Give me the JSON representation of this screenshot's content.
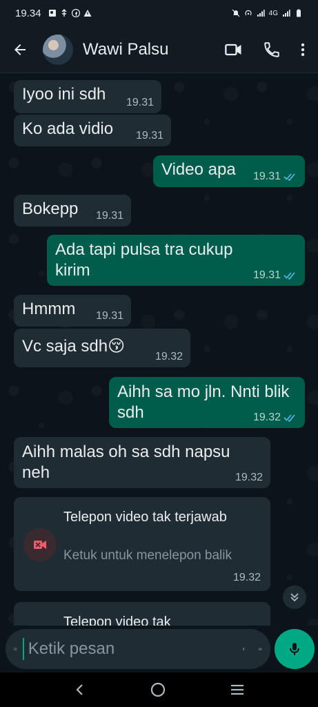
{
  "status_bar": {
    "time": "19.34",
    "network": "4G"
  },
  "header": {
    "contact_name": "Wawi Palsu",
    "icons": [
      "back-arrow-icon",
      "video-call-icon",
      "phone-icon",
      "more-options-icon"
    ]
  },
  "messages": [
    {
      "dir": "in",
      "text": "Iyoo ini sdh",
      "time": "19.31"
    },
    {
      "dir": "in",
      "text": "Ko ada vidio",
      "time": "19.31"
    },
    {
      "dir": "out",
      "text": "Video apa",
      "time": "19.31",
      "read": true
    },
    {
      "dir": "in",
      "text": "Bokepp",
      "time": "19.31"
    },
    {
      "dir": "out",
      "text": "Ada tapi pulsa tra cukup kirim",
      "time": "19.31",
      "read": true
    },
    {
      "dir": "in",
      "text": "Hmmm",
      "time": "19.31"
    },
    {
      "dir": "in",
      "text": "Vc saja sdh😚",
      "time": "19.32"
    },
    {
      "dir": "out",
      "text": "Aihh sa mo jln. Nnti blik sdh",
      "time": "19.32",
      "read": true
    },
    {
      "dir": "in",
      "text": "Aihh malas oh sa sdh napsu neh",
      "time": "19.32"
    }
  ],
  "missed_calls": [
    {
      "title": "Telepon video tak terjawab",
      "subtitle": "Ketuk untuk menelepon balik",
      "time": "19.32"
    },
    {
      "title": "Telepon video tak"
    }
  ],
  "composer": {
    "placeholder": "Ketik pesan"
  },
  "colors": {
    "incoming": "#202c33",
    "outgoing": "#005c4b",
    "accent": "#00a884",
    "read_tick": "#53bdeb"
  }
}
